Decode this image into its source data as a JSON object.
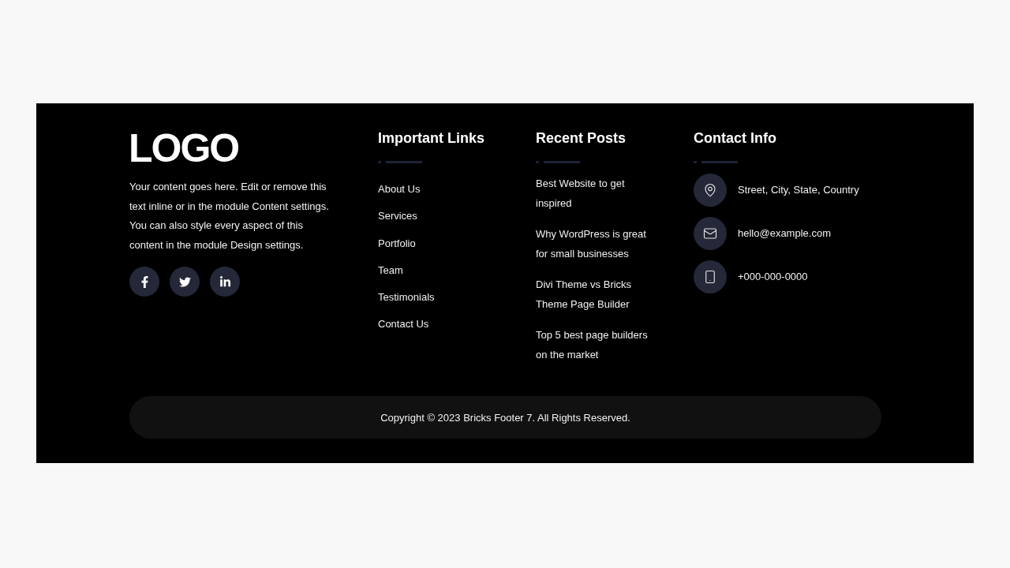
{
  "brand": {
    "logo": "LOGO",
    "description": "Your content goes here. Edit or remove this text inline or in the module Content settings. You can also style every aspect of this content in the module Design settings.",
    "social_links": [
      {
        "kind": "facebook"
      },
      {
        "kind": "twitter"
      },
      {
        "kind": "linkedin"
      }
    ]
  },
  "important_links": {
    "title": "Important Links",
    "items": [
      "About Us",
      "Services",
      "Portfolio",
      "Team",
      "Testimonials",
      "Contact Us"
    ]
  },
  "recent_posts": {
    "title": "Recent Posts",
    "items": [
      "Best Website to get inspired",
      "Why WordPress is great for small businesses",
      "Divi Theme vs Bricks Theme Page Builder",
      "Top 5 best page builders on the market"
    ]
  },
  "contact_info": {
    "title": "Contact Info",
    "items": [
      {
        "kind": "address",
        "text": "Street, City, State, Country"
      },
      {
        "kind": "email",
        "text": "hello@example.com"
      },
      {
        "kind": "phone",
        "text": "+000-000-0000"
      }
    ]
  },
  "copyright": "Copyright © 2023 Bricks Footer 7. All Rights Reserved."
}
